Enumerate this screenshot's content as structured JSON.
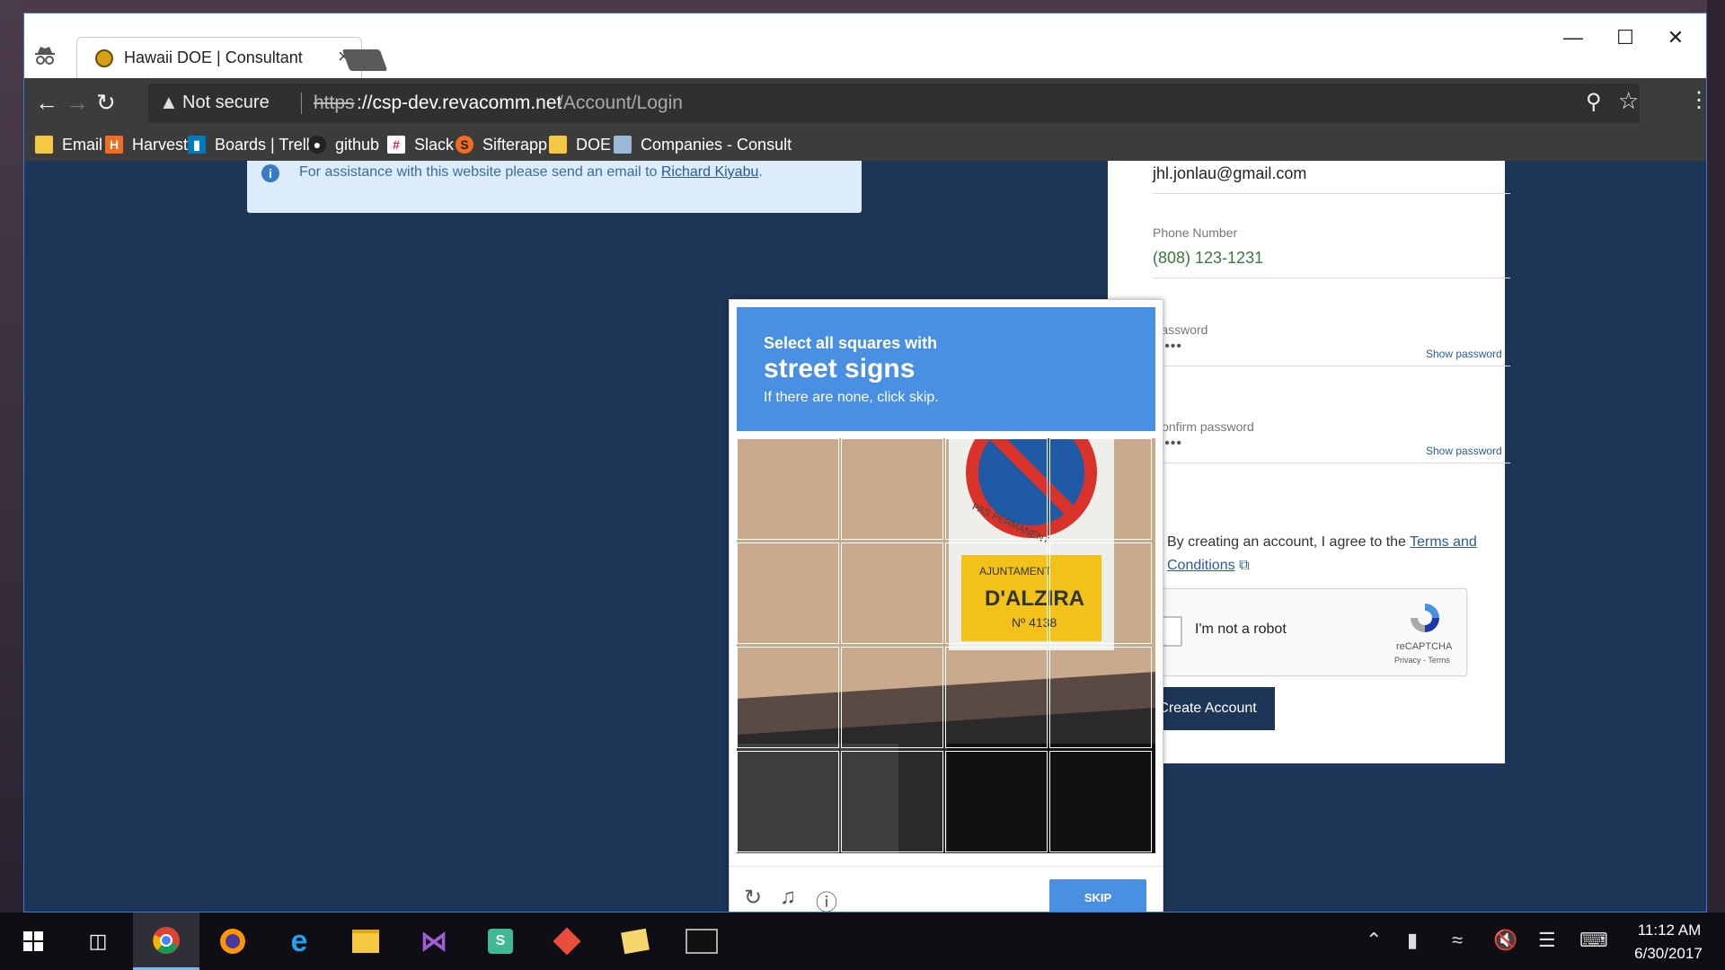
{
  "browser": {
    "tab_title": "Hawaii DOE | Consultant",
    "tab_close": "×",
    "not_secure": "Not secure",
    "url_scheme": "https",
    "url_host": "://csp-dev.revacomm.net",
    "url_path": "/Account/Login",
    "window_min": "—",
    "window_max": "☐",
    "window_close": "✕"
  },
  "bookmarks": [
    {
      "label": "Email",
      "icon": "folder-icon",
      "color": "#f5c842"
    },
    {
      "label": "Harvest",
      "icon": "harvest-icon",
      "color": "#f36c21"
    },
    {
      "label": "Boards | Trello",
      "icon": "trello-icon",
      "color": "#0079bf"
    },
    {
      "label": "github",
      "icon": "github-icon",
      "color": "#222222"
    },
    {
      "label": "Slack",
      "icon": "slack-icon",
      "color": "#e01e5a"
    },
    {
      "label": "Sifterapp",
      "icon": "sifter-icon",
      "color": "#f36c21"
    },
    {
      "label": "DOE",
      "icon": "folder-icon",
      "color": "#f5c842"
    },
    {
      "label": "Companies - Consult",
      "icon": "document-icon",
      "color": "#9ab8d8"
    }
  ],
  "page": {
    "info_text": "For assistance with this website please send an email to ",
    "info_link": "Richard Kiyabu",
    "info_period": ".",
    "email_value": "jhl.jonlau@gmail.com",
    "phone_label": "Phone Number",
    "phone_value": "(808) 123-1231",
    "password_label": "Password",
    "password_dots": "•••••",
    "confirm_label": "Confirm password",
    "confirm_dots": "•••••",
    "show_password": "Show password",
    "agree_text": "By creating an account, I agree to the ",
    "terms_link": "Terms and Conditions",
    "recaptcha_label": "I'm not a robot",
    "recaptcha_brand": "reCAPTCHA",
    "recaptcha_privacy": "Privacy - Terms",
    "create_button": "Create Account",
    "accent_color": "#1d3557"
  },
  "captcha": {
    "line1": "Select all squares with",
    "line2": "street signs",
    "line3": "If there are none, click skip.",
    "skip": "SKIP",
    "sign_text1": "AJUNTAMENT",
    "sign_text2": "D'ALZIRA",
    "sign_text3": "Nº 4138",
    "sign_text4": "PAS PERMANENT",
    "header_color": "#4a90e2"
  },
  "taskbar": {
    "time": "11:12 AM",
    "date": "6/30/2017"
  }
}
